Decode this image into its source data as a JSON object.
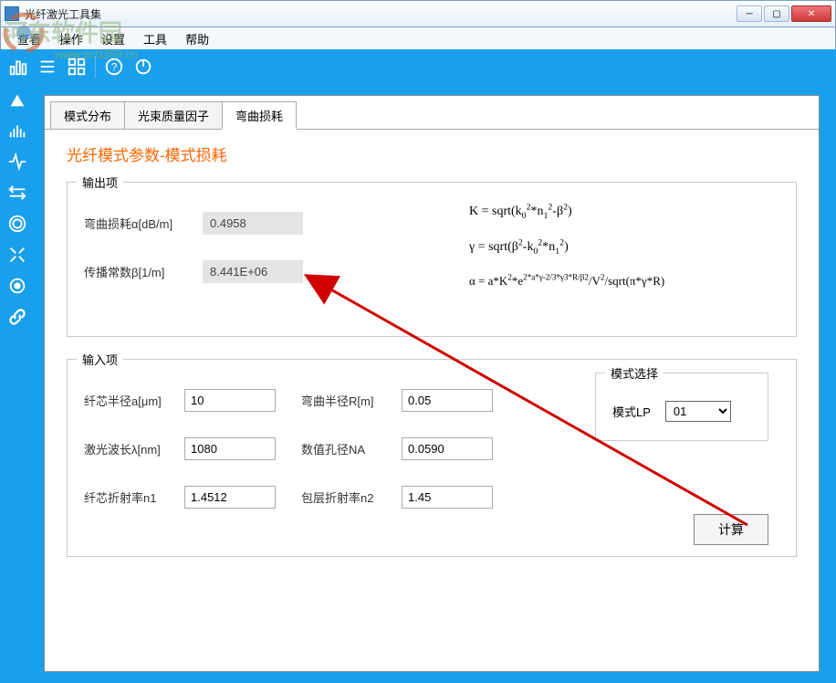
{
  "window": {
    "title": "光纤激光工具集"
  },
  "menu": {
    "view": "查看",
    "operate": "操作",
    "settings": "设置",
    "tools": "工具",
    "help": "帮助"
  },
  "tabs": {
    "t1": "模式分布",
    "t2": "光束质量因子",
    "t3": "弯曲损耗"
  },
  "section_title": "光纤模式参数-模式损耗",
  "output": {
    "group": "输出项",
    "bend_loss_label": "弯曲损耗α[dB/m]",
    "bend_loss_value": "0.4958",
    "beta_label": "传播常数β[1/m]",
    "beta_value": "8.441E+06",
    "formula_k": "K = sqrt(k₀²*n₁²-β²)",
    "formula_gamma": "γ = sqrt(β²-k₀²*n₁²)",
    "formula_alpha": "α = a*K²*e²*ᵃ*ᵞ⁻²/³*ᵞ³*R/β²/V²/sqrt(π*γ*R)"
  },
  "input": {
    "group": "输入项",
    "core_radius_label": "纤芯半径a[μm]",
    "core_radius": "10",
    "bend_radius_label": "弯曲半径R[m]",
    "bend_radius": "0.05",
    "wavelength_label": "激光波长λ[nm]",
    "wavelength": "1080",
    "na_label": "数值孔径NA",
    "na": "0.0590",
    "n1_label": "纤芯折射率n1",
    "n1": "1.4512",
    "n2_label": "包层折射率n2",
    "n2": "1.45"
  },
  "mode": {
    "group": "模式选择",
    "lp_label": "模式LP",
    "lp_value": "01"
  },
  "calc": "计算",
  "watermark": {
    "text": "河东软件园",
    "url": "www.pc0359.cn"
  }
}
